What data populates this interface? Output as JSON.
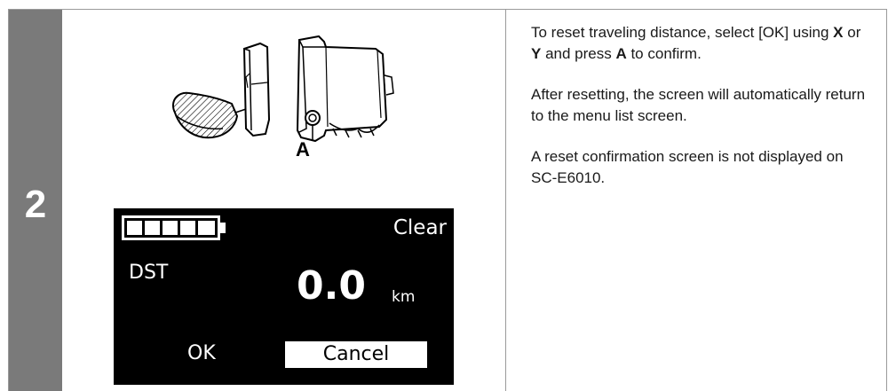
{
  "step": {
    "number": "2"
  },
  "illustration": {
    "callout_label": "A"
  },
  "display": {
    "battery_bars": 5,
    "battery_icon": "battery-full-icon",
    "title": "Clear",
    "field_label": "DST",
    "value": "0.0",
    "unit": "km",
    "option_ok": "OK",
    "option_cancel": "Cancel",
    "selected_option": "Cancel"
  },
  "instructions": {
    "p1_part1": "To reset traveling distance, select [OK] using ",
    "p1_key_x": "X",
    "p1_part2": " or ",
    "p1_key_y": "Y",
    "p1_part3": " and press ",
    "p1_key_a": "A",
    "p1_part4": " to confirm.",
    "p2": "After resetting, the screen will automatically return to the menu list screen.",
    "p3": "A reset confirmation screen is not displayed on SC-E6010."
  },
  "colors": {
    "step_column": "#7a7a7a",
    "display_background": "#000000",
    "display_text": "#ffffff"
  }
}
